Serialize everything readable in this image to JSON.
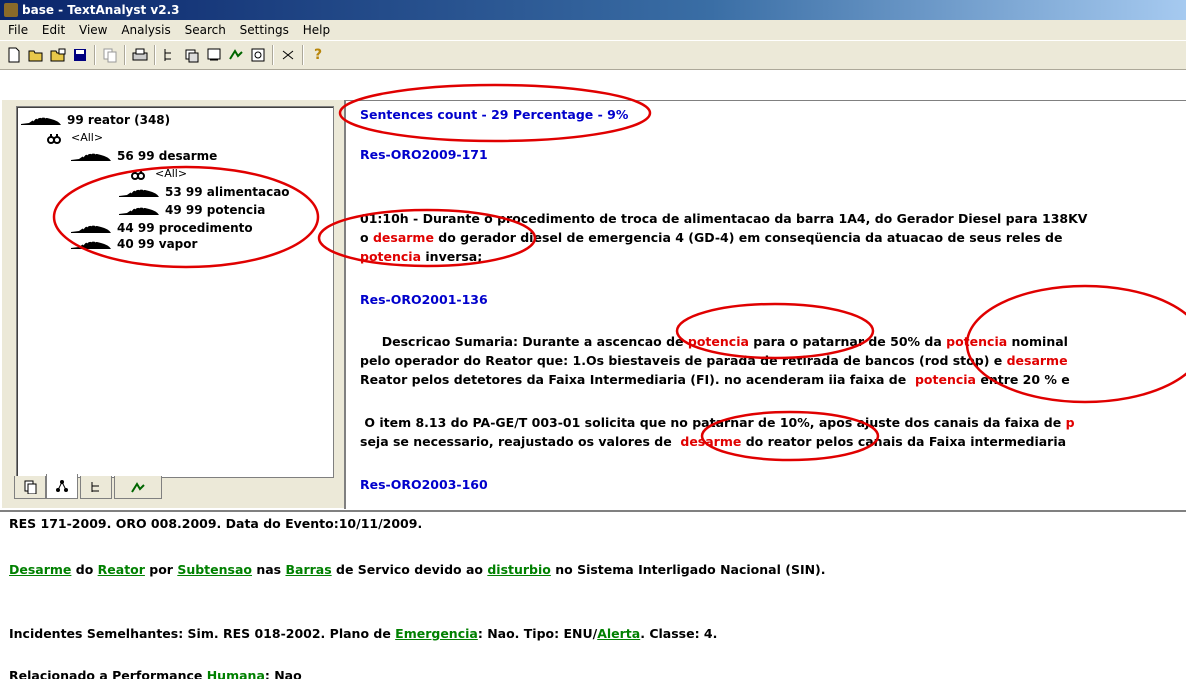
{
  "window": {
    "title": "base - TextAnalyst v2.3"
  },
  "menu": [
    "File",
    "Edit",
    "View",
    "Analysis",
    "Search",
    "Settings",
    "Help"
  ],
  "toolbar": {
    "icons": [
      "new-icon",
      "open-icon",
      "open-base-icon",
      "save-icon",
      "copy-icon",
      "paste-icon",
      "print-icon",
      "tree-icon",
      "semantic-network-icon",
      "summary-icon",
      "search-icon",
      "find-icon",
      "cut-icon",
      "help-icon"
    ]
  },
  "tree": {
    "root": "99 reator (348)",
    "all_label": "<All>",
    "n1": "56 99 desarme",
    "n1_1": "53 99 alimentacao",
    "n1_2": "49 99 potencia",
    "n2": "44 99 procedimento",
    "n3": "40 99 vapor"
  },
  "tabs": [
    "text-tab",
    "tree-tab",
    "topic-tab",
    "search-tab"
  ],
  "right": {
    "header": "Sentences count - 29  Percentage - 9%",
    "ref1": "Res-ORO2009-171",
    "p1_l1": "01:10h - Durante o procedimento de troca de alimentacao da barra 1A4, do Gerador Diesel para 138KV",
    "p1_l2_a": "o ",
    "p1_l2_b": "desarme",
    "p1_l2_c": " do gerador diesel de emergencia 4 (GD-4) em conseqüencia da   atuacao de seus reles de",
    "p1_l3_a": "potencia",
    "p1_l3_b": " inversa;",
    "ref2": "Res-ORO2001-136",
    "p2_l1_a": "     Descricao Sumaria: Durante a ascencao de ",
    "p2_l1_b": "potencia",
    "p2_l1_c": " para o patarnar de 50% da ",
    "p2_l1_d": "potencia",
    "p2_l1_e": " nominal",
    "p2_l2_a": "pelo operador do Reator que:  1.Os biestaveis de parada de retirada de bancos (rod stop) e ",
    "p2_l2_b": "desarme",
    "p2_l3_a": "Reator pelos detetores da Faixa Intermediaria (FI). no acenderam iia faixa de  ",
    "p2_l3_b": "potencia",
    "p2_l3_c": " entre 20 % e",
    "p3_l1_a": " O item 8.13 do PA-GE/T 003-01 solicita que no patarnar de 10%, apos ajuste dos canais da faixa de ",
    "p3_l1_b": "p",
    "p3_l2_a": "seja se necessario, reajustado os valores de  ",
    "p3_l2_b": "desarme",
    "p3_l2_c": " do reator pelos canais da Faixa intermediaria",
    "ref3": "Res-ORO2003-160"
  },
  "bottom": {
    "l1": "RES 171-2009. ORO 008.2009. Data do Evento:10/11/2009.",
    "l2_w1": "Desarme",
    "l2_t1": " do ",
    "l2_w2": "Reator",
    "l2_t2": " por ",
    "l2_w3": "Subtensao",
    "l2_t3": " nas ",
    "l2_w4": "Barras",
    "l2_t4": " de Servico devido ao ",
    "l2_w5": "disturbio",
    "l2_t5": " no Sistema Interligado Nacional (SIN).",
    "l3_t1": "Incidentes Semelhantes: Sim. RES 018-2002. Plano de ",
    "l3_w1": "Emergencia",
    "l3_t2": ": Nao. Tipo: ENU/",
    "l3_w2": "Alerta",
    "l3_t3": ". Classe: 4.",
    "l4_t1": "Relacionado a Performance ",
    "l4_w1": "Humana",
    "l4_t2": ": Nao"
  },
  "colors": {
    "annotation": "#e00000",
    "link": "#008000",
    "heading": "#0000cc",
    "highlight": "#e00000"
  }
}
